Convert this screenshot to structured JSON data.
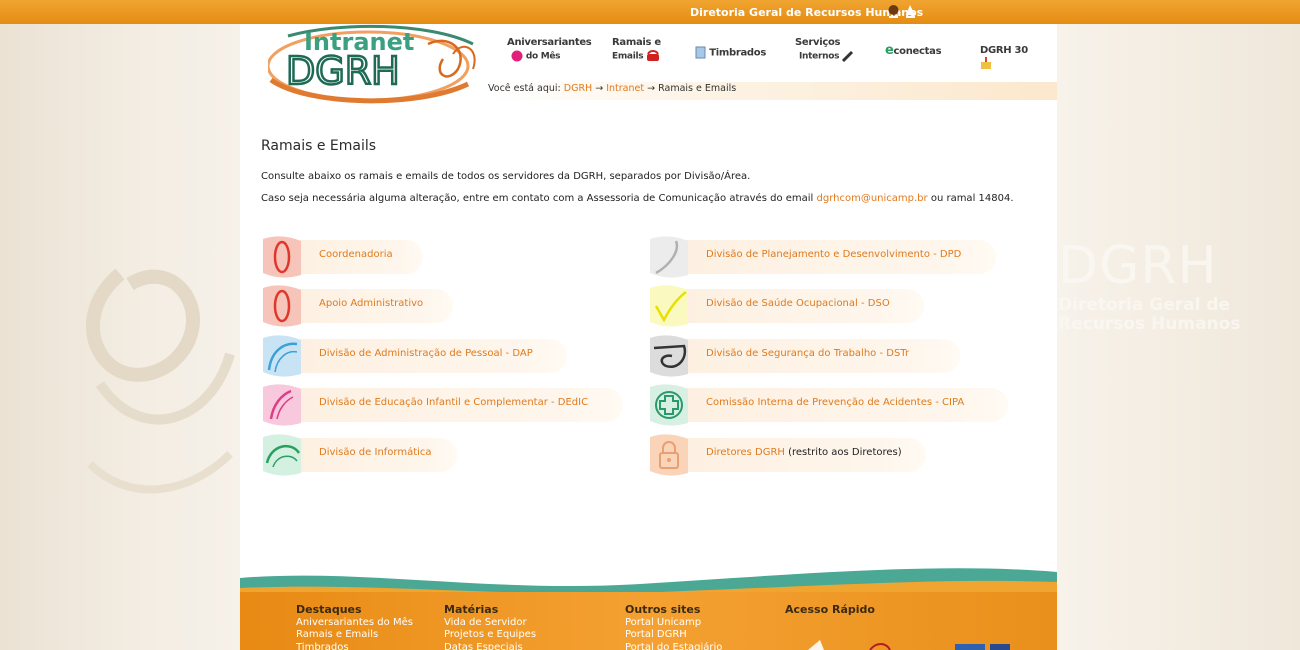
{
  "topbar": {
    "title": "Diretoria Geral de Recursos Humanos"
  },
  "logo": {
    "line1": "Intranet",
    "line2": "DGRH"
  },
  "nav": [
    {
      "line1": "Aniversariantes",
      "line2": "do Mês"
    },
    {
      "line1": "Ramais e",
      "line2": "Emails"
    },
    {
      "line1": "Timbrados",
      "line2": ""
    },
    {
      "line1": "Serviços",
      "line2": "Internos"
    },
    {
      "line1": "conectas",
      "prefix": "e",
      "line2": ""
    },
    {
      "line1": "DGRH 30",
      "line2": ""
    }
  ],
  "breadcrumb": {
    "prefix": "Você está aqui:",
    "items": [
      "DGRH",
      "Intranet",
      "Ramais e Emails"
    ],
    "separator": "→"
  },
  "page": {
    "title": "Ramais e Emails",
    "para1": "Consulte abaixo os ramais e emails de todos os servidores da DGRH, separados por Divisão/Área.",
    "para2_before": "Caso seja necessária alguma alteração, entre em contato com a Assessoria de Comunicação através do email ",
    "para2_email": "dgrhcom@unicamp.br",
    "para2_after": " ou ramal 14804."
  },
  "left_items": [
    {
      "label": "Coordenadoria",
      "icon": "dgrh-red-icon",
      "color": "#e0362b"
    },
    {
      "label": "Apoio Administrativo",
      "icon": "dgrh-red-icon",
      "color": "#e0362b"
    },
    {
      "label": "Divisão de Administração de Pessoal - DAP",
      "icon": "dap-blue-icon",
      "color": "#3aa0d8"
    },
    {
      "label": "Divisão de Educação Infantil e Complementar - DEdIC",
      "icon": "dedic-pink-icon",
      "color": "#e03a8a"
    },
    {
      "label": "Divisão de Informática",
      "icon": "di-green-icon",
      "color": "#2aa060"
    }
  ],
  "right_items": [
    {
      "label": "Divisão de Planejamento e Desenvolvimento - DPD",
      "icon": "dpd-grey-icon",
      "color": "#b8b8b8"
    },
    {
      "label": "Divisão de Saúde Ocupacional - DSO",
      "icon": "dso-yellow-icon",
      "color": "#e8e000"
    },
    {
      "label": "Divisão de Segurança do Trabalho - DSTr",
      "icon": "dstr-black-icon",
      "color": "#333333"
    },
    {
      "label": "Comissão Interna de Prevenção de Acidentes - CIPA",
      "icon": "cipa-cross-icon",
      "color": "#2a9a6a"
    },
    {
      "label": "Diretores DGRH",
      "rest": " (restrito aos Diretores)",
      "icon": "lock-icon",
      "color": "#e8a070"
    }
  ],
  "footer": {
    "col1": {
      "head": "Destaques",
      "links": [
        "Aniversariantes do Mês",
        "Ramais e Emails",
        "Timbrados"
      ]
    },
    "col2": {
      "head": "Matérias",
      "links": [
        "Vida de Servidor",
        "Projetos e Equipes",
        "Datas Especiais"
      ]
    },
    "col3": {
      "head": "Outros sites",
      "links": [
        "Portal Unicamp",
        "Portal DGRH",
        "Portal do Estagiário"
      ]
    },
    "col4": {
      "head": "Acesso Rápido",
      "links": []
    }
  },
  "watermark": {
    "big": "DGRH",
    "small1": "Diretoria Geral de",
    "small2": "Recursos Humanos"
  },
  "colors": {
    "accent": "#e07a1e",
    "topbar": "#e8951f",
    "teal": "#4aa894"
  }
}
